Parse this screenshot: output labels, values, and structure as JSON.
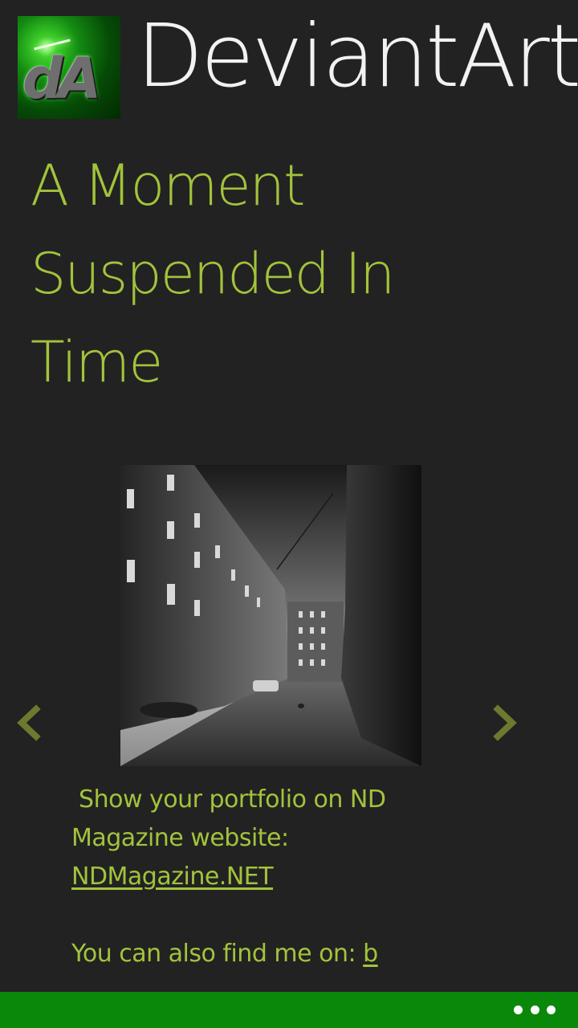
{
  "header": {
    "app_title": "DeviantArt",
    "logo_text": "dA",
    "logo_icon": "deviantart-logo-icon"
  },
  "artwork": {
    "title": "A Moment Suspended In Time",
    "image_icon": "artwork-photo"
  },
  "navigation": {
    "prev_icon": "chevron-left-icon",
    "next_icon": "chevron-right-icon"
  },
  "description": {
    "line1": " Show your portfolio on ND",
    "line2": "Magazine website:",
    "link": "NDMagazine.NET",
    "line4_prefix": "You can also find me on: ",
    "line4_link": "b"
  },
  "app_bar": {
    "more_icon": "ellipsis-icon"
  },
  "colors": {
    "background": "#222222",
    "accent": "#a2c33c",
    "app_bar": "#0a880a",
    "title_text": "#f2f2f2",
    "nav_arrow": "#6b7a2e"
  }
}
